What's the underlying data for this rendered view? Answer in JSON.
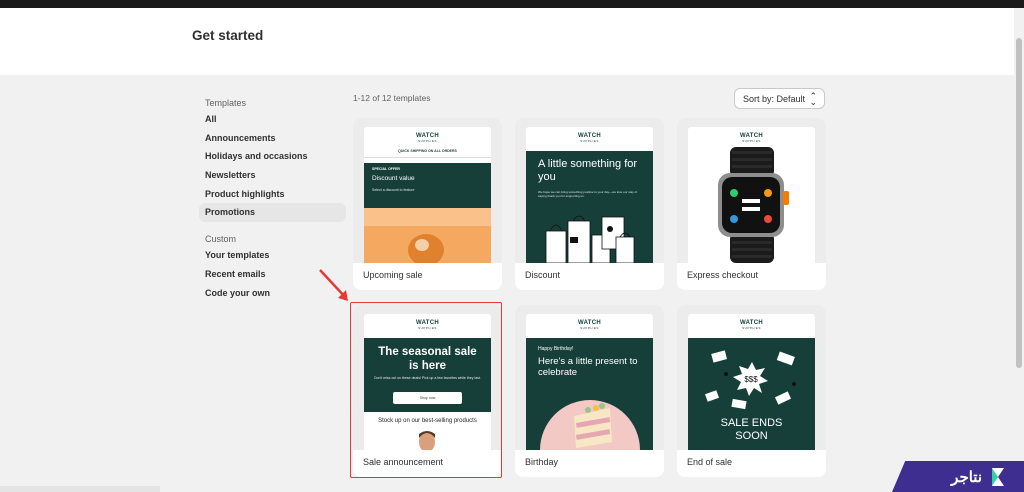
{
  "header": {
    "title": "Get started"
  },
  "sidebar": {
    "templates_title": "Templates",
    "templates_items": [
      "All",
      "Announcements",
      "Holidays and occasions",
      "Newsletters",
      "Product highlights",
      "Promotions"
    ],
    "active": "Promotions",
    "custom_title": "Custom",
    "custom_items": [
      "Your templates",
      "Recent emails",
      "Code your own"
    ]
  },
  "toolbar": {
    "count": "1-12 of 12 templates",
    "sort_label": "Sort by: Default"
  },
  "email": {
    "logo": "WATCH",
    "logo_sub": "SUPPLIES"
  },
  "cards": [
    {
      "label": "Upcoming sale",
      "banner": "QUICK SHIPPING ON ALL ORDERS",
      "kicker": "SPECIAL OFFER",
      "title": "Discount value",
      "body": "Select a discount to feature"
    },
    {
      "label": "Discount",
      "title": "A little something for you",
      "body": "We hope we can bring something positive to your day—we love our way of saying thank you for supporting us."
    },
    {
      "label": "Express checkout"
    },
    {
      "label": "Sale announcement",
      "title": "The seasonal sale is here",
      "body": "Don't miss out on these deals! Pick up a few favorites while they last.",
      "button": "Shop now",
      "sub": "Stock up on our best-selling products"
    },
    {
      "label": "Birthday",
      "kicker": "Happy Birthday!",
      "title": "Here's a little present to celebrate"
    },
    {
      "label": "End of sale",
      "title": "SALE ENDS SOON"
    }
  ],
  "brand": {
    "name": "نتاجر"
  },
  "colors": {
    "accent_green": "#173f3a",
    "highlight": "#e53935",
    "brand": "#3d2e8f"
  }
}
